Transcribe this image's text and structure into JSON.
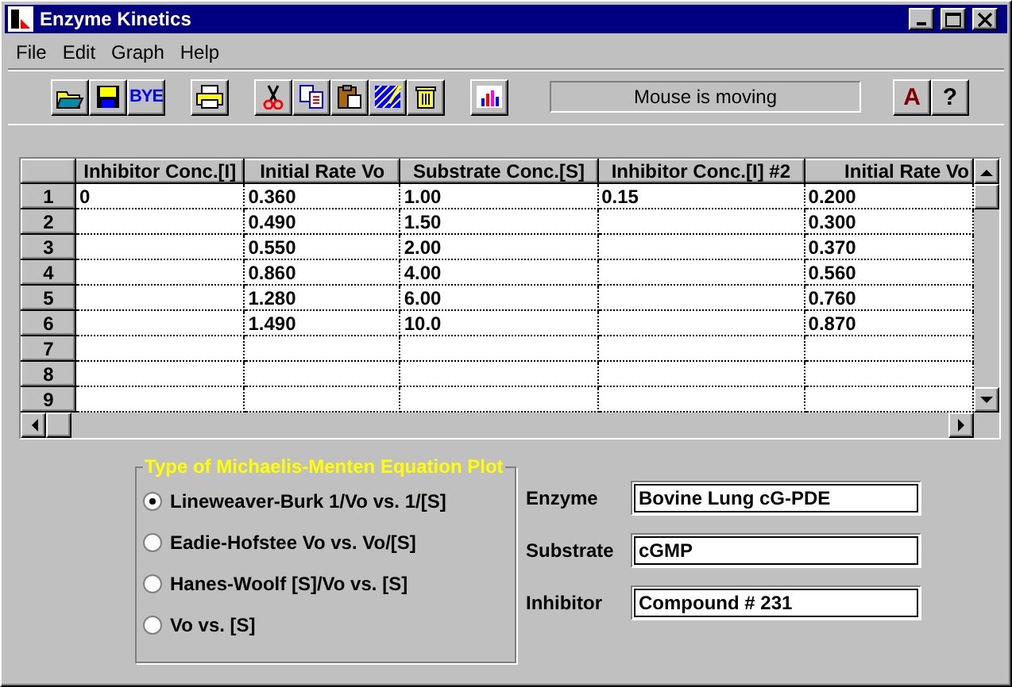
{
  "window": {
    "title": "Enzyme Kinetics"
  },
  "menu": [
    "File",
    "Edit",
    "Graph",
    "Help"
  ],
  "toolbar": [
    {
      "kind": "open"
    },
    {
      "kind": "save"
    },
    {
      "kind": "text",
      "label": "BYE"
    },
    {
      "kind": "print",
      "gap": true
    },
    {
      "kind": "cut",
      "gap": true
    },
    {
      "kind": "copy"
    },
    {
      "kind": "paste"
    },
    {
      "kind": "fill"
    },
    {
      "kind": "trash"
    },
    {
      "kind": "chart",
      "gap": true
    }
  ],
  "status": "Mouse is moving",
  "help_buttons": [
    {
      "label": "A",
      "color": "#800000"
    },
    {
      "label": "?",
      "color": "#000000"
    }
  ],
  "table": {
    "columns": [
      "Inhibitor Conc.[I]",
      "Initial Rate Vo",
      "Substrate Conc.[S]",
      "Inhibitor Conc.[I] #2",
      "Initial Rate Vo"
    ],
    "rows": [
      {
        "label": "1",
        "cells": [
          "0",
          "0.360",
          "1.00",
          "0.15",
          "0.200"
        ]
      },
      {
        "label": "2",
        "cells": [
          null,
          "0.490",
          "1.50",
          null,
          "0.300"
        ]
      },
      {
        "label": "3",
        "cells": [
          null,
          "0.550",
          "2.00",
          null,
          "0.370"
        ]
      },
      {
        "label": "4",
        "cells": [
          null,
          "0.860",
          "4.00",
          null,
          "0.560"
        ]
      },
      {
        "label": "5",
        "cells": [
          null,
          "1.280",
          "6.00",
          null,
          "0.760"
        ]
      },
      {
        "label": "6",
        "cells": [
          null,
          "1.490",
          "10.0",
          null,
          "0.870"
        ]
      },
      {
        "label": "7",
        "cells": [
          null,
          null,
          null,
          null,
          null
        ]
      },
      {
        "label": "8",
        "cells": [
          null,
          null,
          null,
          null,
          null
        ]
      },
      {
        "label": "9",
        "cells": [
          null,
          null,
          null,
          null,
          null
        ]
      }
    ]
  },
  "plot_type": {
    "title": "Type of Michaelis-Menten Equation Plot",
    "options": [
      {
        "label": "Lineweaver-Burk 1/Vo vs. 1/[S]",
        "selected": true
      },
      {
        "label": "Eadie-Hofstee Vo vs. Vo/[S]",
        "selected": false
      },
      {
        "label": "Hanes-Woolf [S]/Vo vs. [S]",
        "selected": false
      },
      {
        "label": "Vo vs. [S]",
        "selected": false
      }
    ]
  },
  "fields": [
    {
      "label": "Enzyme",
      "value": "Bovine Lung cG-PDE"
    },
    {
      "label": "Substrate",
      "value": "cGMP"
    },
    {
      "label": "Inhibitor",
      "value": "Compound # 231"
    }
  ]
}
